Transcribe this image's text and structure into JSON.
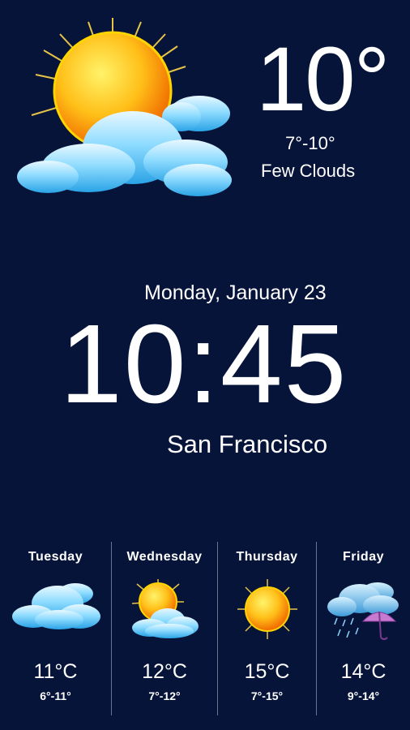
{
  "current": {
    "icon": "sun-with-clouds-icon",
    "temperature": "10°",
    "range": "7°-10°",
    "condition": "Few Clouds"
  },
  "clock": {
    "date": "Monday, January 23",
    "time": "10:45",
    "city": "San Francisco"
  },
  "forecast": [
    {
      "day": "Tuesday",
      "icon": "cloudy-icon",
      "high": "11°C",
      "range": "6°-11°"
    },
    {
      "day": "Wednesday",
      "icon": "partly-cloudy-icon",
      "high": "12°C",
      "range": "7°-12°"
    },
    {
      "day": "Thursday",
      "icon": "sunny-icon",
      "high": "15°C",
      "range": "7°-15°"
    },
    {
      "day": "Friday",
      "icon": "rain-umbrella-icon",
      "high": "14°C",
      "range": "9°-14°"
    }
  ],
  "colors": {
    "background": "#07143a",
    "text": "#ffffff",
    "sun": "#ffb400",
    "cloud": "#7fd0ff"
  }
}
